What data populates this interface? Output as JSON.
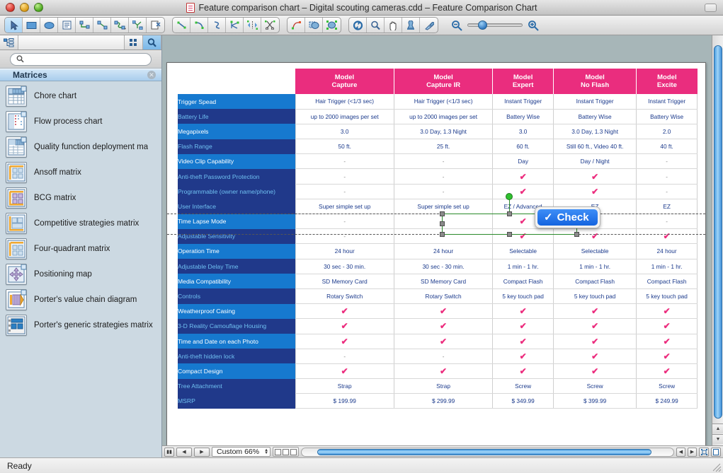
{
  "window": {
    "title": "Feature comparison chart – Digital scouting cameras.cdd – Feature Comparison Chart",
    "doc_icon": "document-icon",
    "traffic_lights": [
      "close-button",
      "minimize-button",
      "zoom-button"
    ]
  },
  "toolbar": {
    "groups": [
      {
        "name": "tools",
        "buttons": [
          {
            "icon": "pointer-icon",
            "active": true
          },
          {
            "icon": "rectangle-icon",
            "active": false
          },
          {
            "icon": "ellipse-icon",
            "active": false
          },
          {
            "icon": "text-block-icon",
            "active": false
          },
          {
            "icon": "smart-connector-icon",
            "active": false
          },
          {
            "icon": "direct-connector-icon",
            "active": false
          },
          {
            "icon": "round-connector-icon",
            "active": false
          },
          {
            "icon": "tree-connector-icon",
            "active": false
          },
          {
            "icon": "delete-connector-icon",
            "active": false
          }
        ]
      },
      {
        "name": "line-tools",
        "buttons": [
          {
            "icon": "line-icon",
            "active": false
          },
          {
            "icon": "arc-icon",
            "active": false
          },
          {
            "icon": "bezier-icon",
            "active": false
          },
          {
            "icon": "polyline-icon",
            "active": false
          },
          {
            "icon": "mirror-icon",
            "active": false
          },
          {
            "icon": "scissors-icon",
            "active": false
          }
        ]
      },
      {
        "name": "shape-ops",
        "buttons": [
          {
            "icon": "reshape-icon",
            "active": false
          },
          {
            "icon": "union-icon",
            "active": false
          },
          {
            "icon": "group-icon",
            "active": false
          }
        ]
      },
      {
        "name": "view-tools",
        "buttons": [
          {
            "icon": "rotate-icon",
            "active": false
          },
          {
            "icon": "magnifier-icon",
            "active": false
          },
          {
            "icon": "hand-icon",
            "active": false
          },
          {
            "icon": "stamp-icon",
            "active": false
          },
          {
            "icon": "eyedropper-icon",
            "active": false
          }
        ]
      }
    ],
    "zoom_out_icon": "zoom-out-icon",
    "zoom_in_icon": "zoom-in-icon"
  },
  "sidebar": {
    "tabs": [
      {
        "icon": "tree-view-icon",
        "selected": false
      },
      {
        "icon": "grid-view-icon",
        "selected": false
      },
      {
        "icon": "search-icon",
        "selected": true
      }
    ],
    "search": {
      "value": "",
      "placeholder": "",
      "icon": "search-icon"
    },
    "section_title": "Matrices",
    "close_icon": "close-section-icon",
    "items": [
      {
        "label": "Chore chart",
        "icon": "chore-chart-icon"
      },
      {
        "label": "Flow process chart",
        "icon": "flow-process-chart-icon"
      },
      {
        "label": "Quality function deployment ma",
        "icon": "qfd-matrix-icon"
      },
      {
        "label": "Ansoff matrix",
        "icon": "ansoff-matrix-icon"
      },
      {
        "label": "BCG matrix",
        "icon": "bcg-matrix-icon"
      },
      {
        "label": "Competitive strategies matrix",
        "icon": "competitive-strategies-icon"
      },
      {
        "label": "Four-quadrant matrix",
        "icon": "four-quadrant-icon"
      },
      {
        "label": "Positioning map",
        "icon": "positioning-map-icon"
      },
      {
        "label": "Porter's value chain diagram",
        "icon": "value-chain-icon"
      },
      {
        "label": "Porter's generic strategies matrix",
        "icon": "generic-strategies-icon"
      }
    ]
  },
  "colors": {
    "header_magenta": "#ea2d7e",
    "row_light_blue": "#1679cf",
    "row_dark_blue": "#20398a",
    "check_pink": "#ec2d7e",
    "cell_text": "#1b3a8c",
    "selection_green": "#2fc02f"
  },
  "tooltip": {
    "label": "Check",
    "check_glyph": "✓"
  },
  "chart_data": {
    "type": "table",
    "title": "Feature Comparison Chart",
    "columns": [
      "",
      "Model Capture",
      "Model Capture IR",
      "Model Expert",
      "Model No Flash",
      "Model Excite"
    ],
    "column_headers": [
      {
        "line1": "Model",
        "line2": "Capture"
      },
      {
        "line1": "Model",
        "line2": "Capture IR"
      },
      {
        "line1": "Model",
        "line2": "Expert"
      },
      {
        "line1": "Model",
        "line2": "No Flash"
      },
      {
        "line1": "Model",
        "line2": "Excite"
      }
    ],
    "rows": [
      {
        "label": "Trigger Spead",
        "style": "lt",
        "values": [
          "Hair Trigger (<1/3 sec)",
          "Hair Trigger (<1/3 sec)",
          "Instant Trigger",
          "Instant Trigger",
          "Instant Trigger"
        ]
      },
      {
        "label": "Battery Life",
        "style": "dk",
        "values": [
          "up to 2000 images per set",
          "up to 2000 images per set",
          "Battery Wise",
          "Battery Wise",
          "Battery Wise"
        ]
      },
      {
        "label": "Megapixels",
        "style": "lt",
        "values": [
          "3.0",
          "3.0 Day, 1.3 Night",
          "3.0",
          "3.0 Day, 1.3 Night",
          "2.0"
        ]
      },
      {
        "label": "Flash Range",
        "style": "dk",
        "values": [
          "50 ft.",
          "25 ft.",
          "60 ft.",
          "Still 60 ft., Video 40 ft.",
          "40 ft."
        ]
      },
      {
        "label": "Video Clip Capability",
        "style": "lt",
        "values": [
          "-",
          "-",
          "Day",
          "Day / Night",
          "-"
        ]
      },
      {
        "label": "Anti-theft Password Protection",
        "style": "dk",
        "values": [
          "-",
          "-",
          "check",
          "check",
          "-"
        ]
      },
      {
        "label": "Programmable (owner name/phone)",
        "style": "dk",
        "values": [
          "-",
          "-",
          "check",
          "check",
          "-"
        ]
      },
      {
        "label": "User Interface",
        "style": "dk",
        "values": [
          "Super simple set up",
          "Super simple set up",
          "EZ / Advanced",
          "EZ",
          "EZ"
        ]
      },
      {
        "label": "Time Lapse Mode",
        "style": "lt",
        "values": [
          "-",
          "-",
          "check",
          "check",
          "-"
        ]
      },
      {
        "label": "Adjustable Sensitivity",
        "style": "dk",
        "values": [
          "-",
          "-",
          "check",
          "check",
          "check"
        ]
      },
      {
        "label": "Operation Time",
        "style": "lt",
        "values": [
          "24 hour",
          "24 hour",
          "Selectable",
          "Selectable",
          "24 hour"
        ]
      },
      {
        "label": "Adjustable Delay Time",
        "style": "dk",
        "values": [
          "30 sec - 30 min.",
          "30 sec - 30 min.",
          "1 min - 1 hr.",
          "1 min - 1 hr.",
          "1 min - 1 hr."
        ]
      },
      {
        "label": "Media Compatibility",
        "style": "lt",
        "values": [
          "SD Memory Card",
          "SD Memory Card",
          "Compact Flash",
          "Compact Flash",
          "Compact Flash"
        ]
      },
      {
        "label": "Controls",
        "style": "dk",
        "values": [
          "Rotary Switch",
          "Rotary Switch",
          "5 key touch pad",
          "5 key touch pad",
          "5 key touch pad"
        ]
      },
      {
        "label": "Weatherproof Casing",
        "style": "lt",
        "values": [
          "check",
          "check",
          "check",
          "check",
          "check"
        ]
      },
      {
        "label": "3-D Reality Camouflage Housing",
        "style": "dk",
        "values": [
          "check",
          "check",
          "check",
          "check",
          "check"
        ]
      },
      {
        "label": "Time and Date on each Photo",
        "style": "lt",
        "values": [
          "check",
          "check",
          "check",
          "check",
          "check"
        ]
      },
      {
        "label": "Anti-theft hidden lock",
        "style": "dk",
        "values": [
          "-",
          "-",
          "check",
          "check",
          "check"
        ]
      },
      {
        "label": "Compact Design",
        "style": "lt",
        "values": [
          "check",
          "check",
          "check",
          "check",
          "check"
        ]
      },
      {
        "label": "Tree Attachment",
        "style": "dk",
        "values": [
          "Strap",
          "Strap",
          "Screw",
          "Screw",
          "Screw"
        ]
      },
      {
        "label": "MSRP",
        "style": "dk",
        "values": [
          "$ 199.99",
          "$ 299.99",
          "$ 349.99",
          "$ 399.99",
          "$ 249.99"
        ]
      }
    ]
  },
  "bottombar": {
    "pause_icon": "pause-icon",
    "prev_icon": "prev-page-icon",
    "next_icon": "next-page-icon",
    "zoom_value": "Custom 66%",
    "view_buttons": [
      "view-normal-icon",
      "view-split-icon",
      "view-full-icon"
    ],
    "scroll_left_icon": "scroll-left-icon",
    "scroll_right_icon": "scroll-right-icon",
    "fit_icon": "fit-page-icon",
    "page_icon": "page-icon"
  },
  "statusbar": {
    "text": "Ready"
  }
}
